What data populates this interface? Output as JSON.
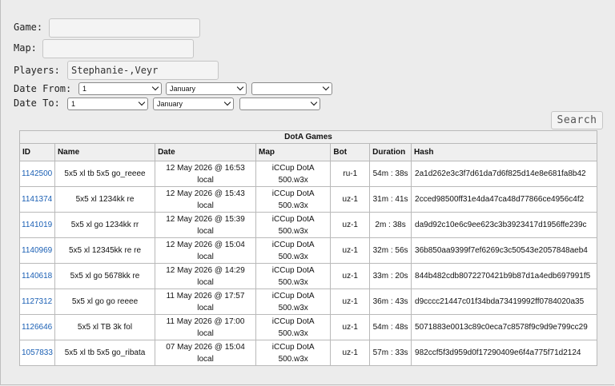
{
  "form": {
    "game_label": "Game:",
    "game_value": "",
    "map_label": "Map:",
    "map_value": "",
    "players_label": "Players:",
    "players_value": "Stephanie-,Veyr",
    "date_from_label": "Date From:",
    "date_to_label": "Date To:",
    "date_from": {
      "day": "1",
      "month": "January",
      "year": ""
    },
    "date_to": {
      "day": "1",
      "month": "January",
      "year": ""
    },
    "search_label": "Search"
  },
  "table": {
    "caption": "DotA Games",
    "headers": [
      "ID",
      "Name",
      "Date",
      "Map",
      "Bot",
      "Duration",
      "Hash"
    ],
    "rows": [
      {
        "id": "1142500",
        "name": "5x5 xl tb 5x5 go_reeee",
        "date": "12 May 2026 @ 16:53",
        "date_tz": "local",
        "map": "iCCup DotA",
        "map_file": "500.w3x",
        "bot": "ru-1",
        "duration": "54m : 38s",
        "hash": "2a1d262e3c3f7d61da7d6f825d14e8e681fa8b42"
      },
      {
        "id": "1141374",
        "name": "5x5 xl 1234kk re",
        "date": "12 May 2026 @ 15:43",
        "date_tz": "local",
        "map": "iCCup DotA",
        "map_file": "500.w3x",
        "bot": "uz-1",
        "duration": "31m : 41s",
        "hash": "2cced98500ff31e4da47ca48d77866ce4956c4f2"
      },
      {
        "id": "1141019",
        "name": "5x5 xl go 1234kk rr",
        "date": "12 May 2026 @ 15:39",
        "date_tz": "local",
        "map": "iCCup DotA",
        "map_file": "500.w3x",
        "bot": "uz-1",
        "duration": "2m : 38s",
        "hash": "da9d92c10e6c9ee623c3b3923417d1956ffe239c"
      },
      {
        "id": "1140969",
        "name": "5x5 xl 12345kk re re",
        "date": "12 May 2026 @ 15:04",
        "date_tz": "local",
        "map": "iCCup DotA",
        "map_file": "500.w3x",
        "bot": "uz-1",
        "duration": "32m : 56s",
        "hash": "36b850aa9399f7ef6269c3c50543e2057848aeb4"
      },
      {
        "id": "1140618",
        "name": "5x5 xl go 5678kk re",
        "date": "12 May 2026 @ 14:29",
        "date_tz": "local",
        "map": "iCCup DotA",
        "map_file": "500.w3x",
        "bot": "uz-1",
        "duration": "33m : 20s",
        "hash": "844b482cdb8072270421b9b87d1a4edb697991f5"
      },
      {
        "id": "1127312",
        "name": "5x5 xl go go reeee",
        "date": "11 May 2026 @ 17:57",
        "date_tz": "local",
        "map": "iCCup DotA",
        "map_file": "500.w3x",
        "bot": "uz-1",
        "duration": "36m : 43s",
        "hash": "d9cccc21447c01f34bda73419992ff0784020a35"
      },
      {
        "id": "1126646",
        "name": "5x5 xl TB 3k fol",
        "date": "11 May 2026 @ 17:00",
        "date_tz": "local",
        "map": "iCCup DotA",
        "map_file": "500.w3x",
        "bot": "uz-1",
        "duration": "54m : 48s",
        "hash": "5071883e0013c89c0eca7c8578f9c9d9e799cc29"
      },
      {
        "id": "1057833",
        "name": "5x5 xl tb 5x5 go_ribata",
        "date": "07 May 2026 @ 15:04",
        "date_tz": "local",
        "map": "iCCup DotA",
        "map_file": "500.w3x",
        "bot": "uz-1",
        "duration": "57m : 33s",
        "hash": "982ccf5f3d959d0f17290409e6f4a775f71d2124"
      }
    ]
  }
}
